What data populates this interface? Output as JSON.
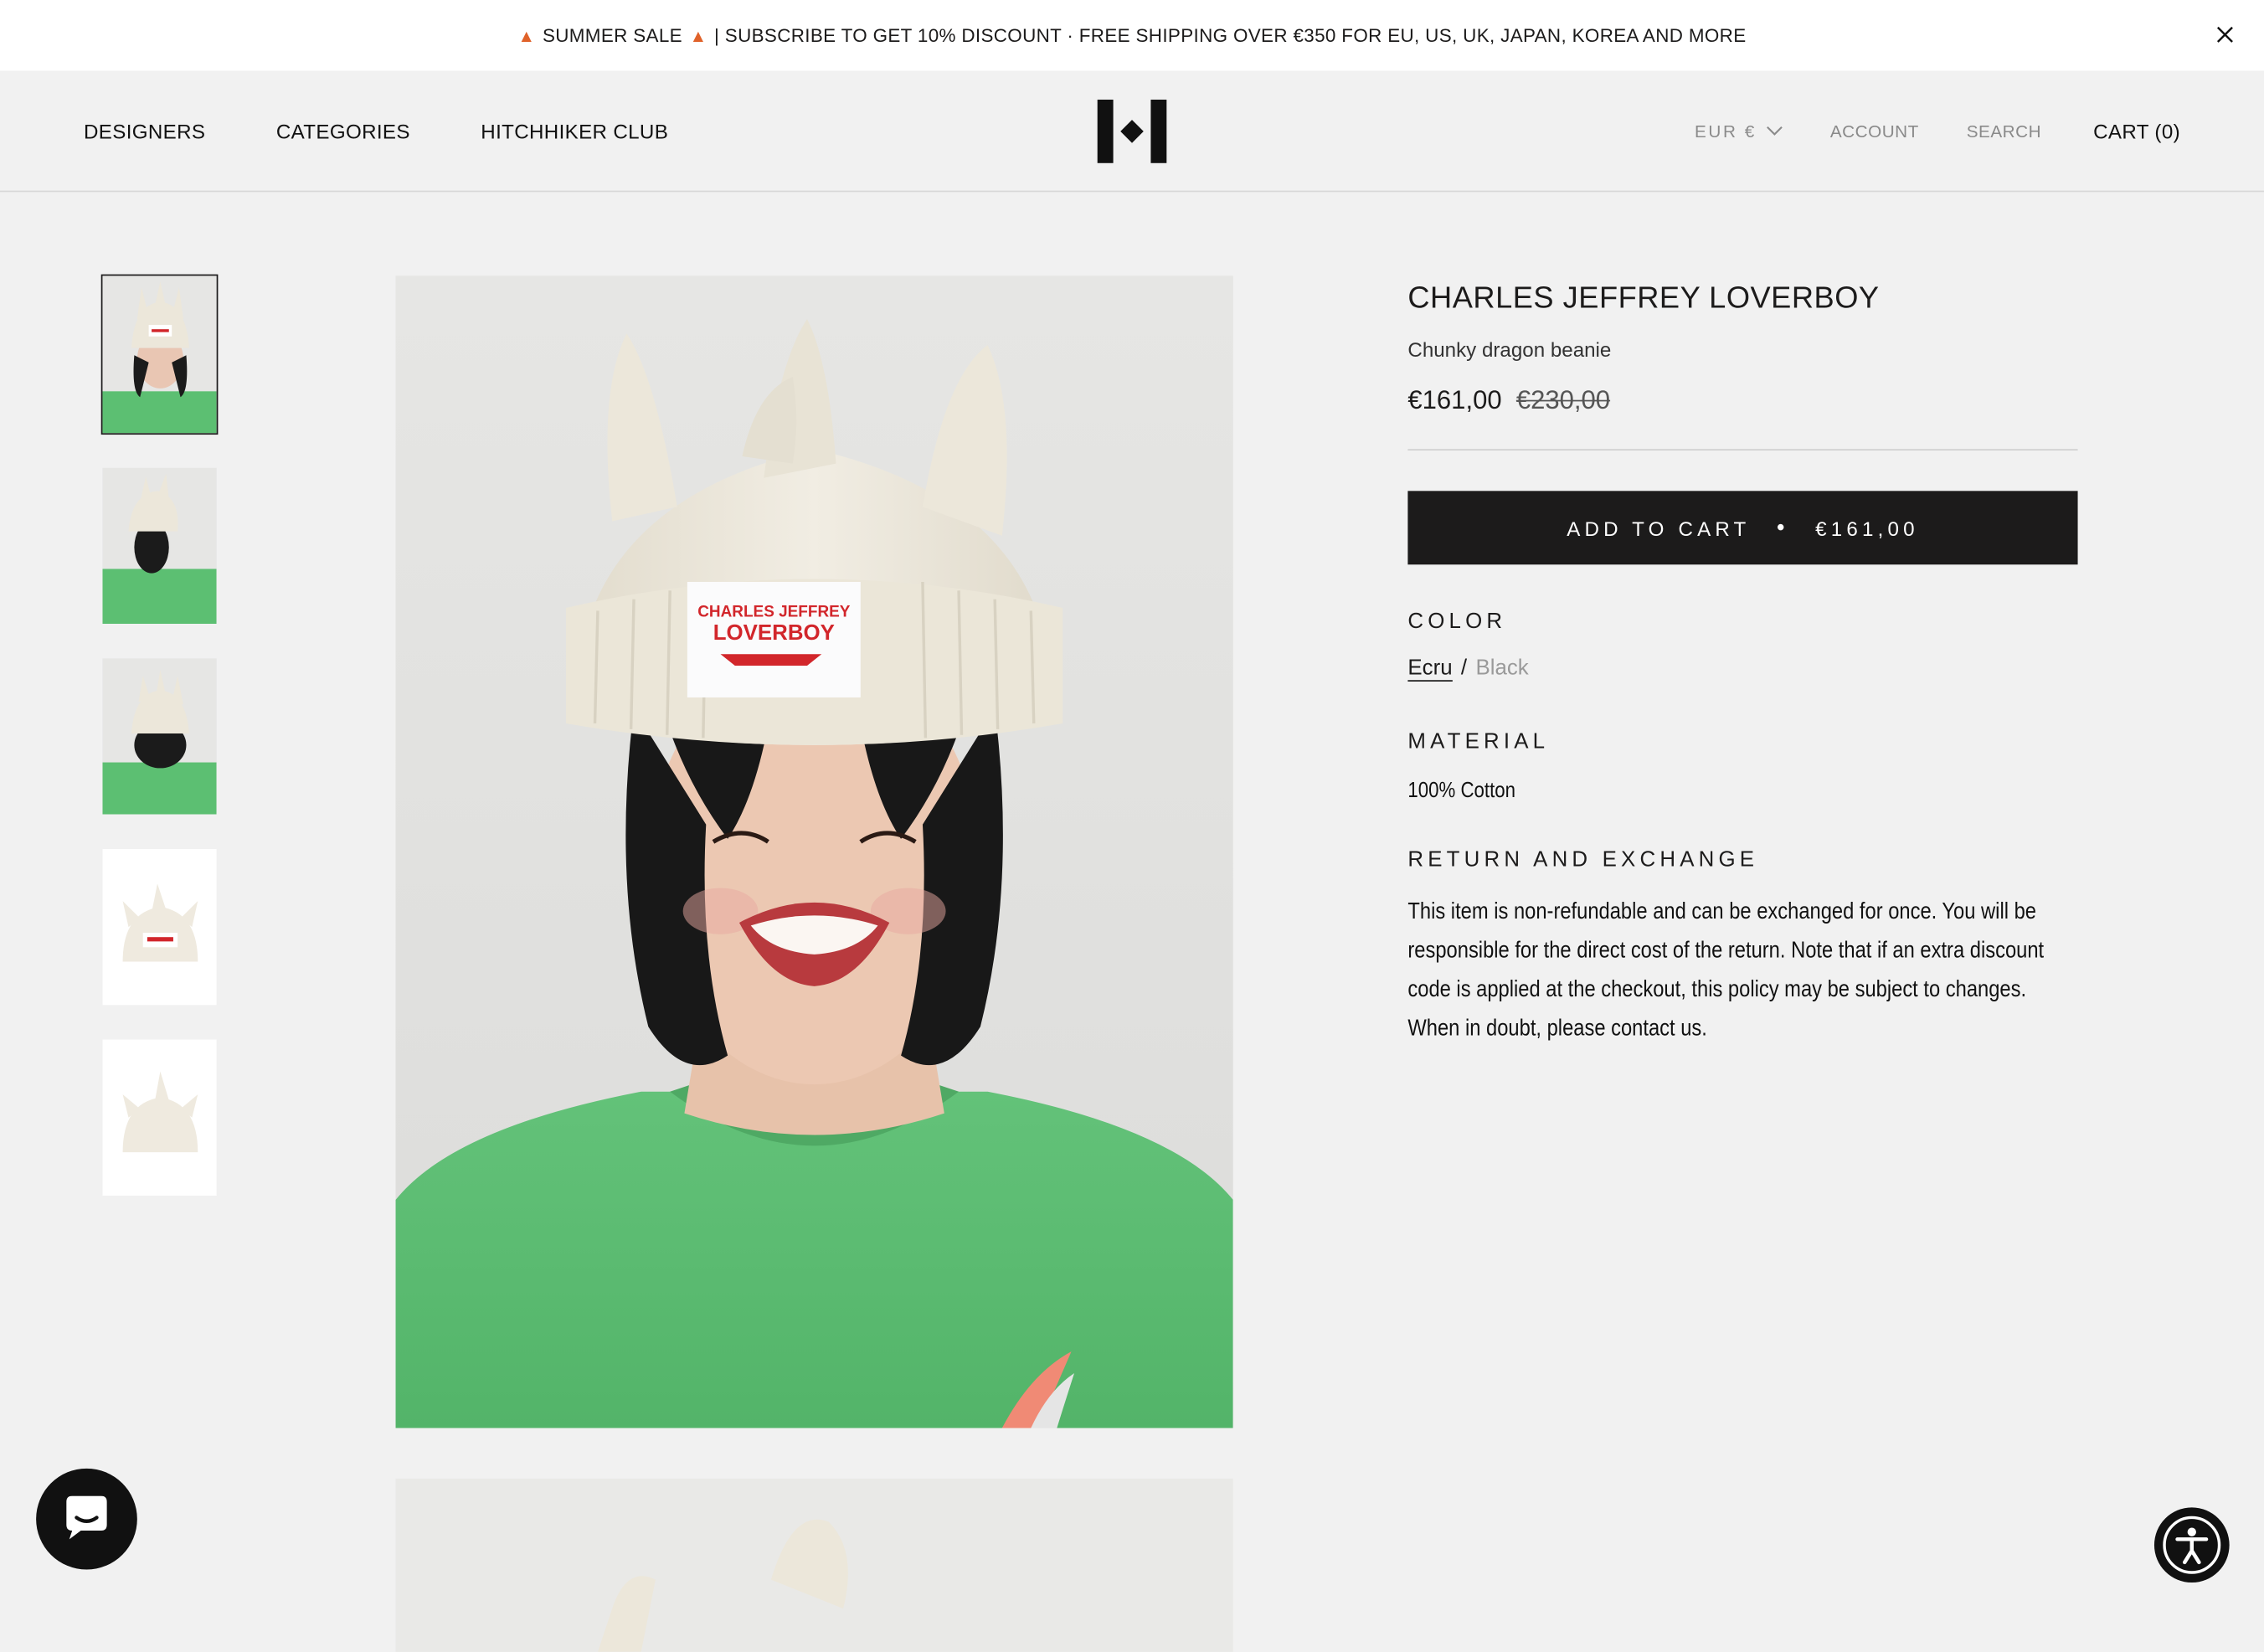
{
  "announcement": {
    "text": "SUMMER SALE",
    "emoji": "🍉",
    "text2": "| SUBSCRIBE TO GET 10% DISCOUNT · FREE SHIPPING OVER €350 FOR EU, US, UK, JAPAN, KOREA AND MORE",
    "close_icon": "close-icon"
  },
  "header": {
    "nav_left": [
      "DESIGNERS",
      "CATEGORIES",
      "HITCHHIKER CLUB"
    ],
    "logo": "store-logo",
    "currency": "EUR €",
    "account": "ACCOUNT",
    "search": "SEARCH",
    "cart": "CART (0)"
  },
  "gallery": {
    "thumbnail_count": 5,
    "active_index": 0
  },
  "product": {
    "brand": "CHARLES JEFFREY LOVERBOY",
    "title": "Chunky dragon beanie",
    "price": "€161,00",
    "compare_price": "€230,00",
    "add_to_cart_label": "ADD TO CART",
    "add_to_cart_price": "€161,00",
    "color_label": "COLOR",
    "colors": [
      "Ecru",
      "Black"
    ],
    "selected_color": "Ecru",
    "material_label": "MATERIAL",
    "material": "100% Cotton",
    "return_label": "RETURN AND EXCHANGE",
    "return_text": "This item is non-refundable and can be exchanged for once. You will be responsible for the direct cost of the return. Note that if an extra discount code is applied at the checkout, this policy may be subject to changes. When in doubt, please contact us."
  },
  "image_patch": {
    "label_line1": "CHARLES JEFFREY",
    "label_line2": "LOVERBOY"
  },
  "colors": {
    "button_bg": "#1c1b1b",
    "page_bg": "#f1f1f1",
    "sweater": "#5cbf72",
    "beanie": "#ece7da",
    "label_red": "#d2262b"
  }
}
